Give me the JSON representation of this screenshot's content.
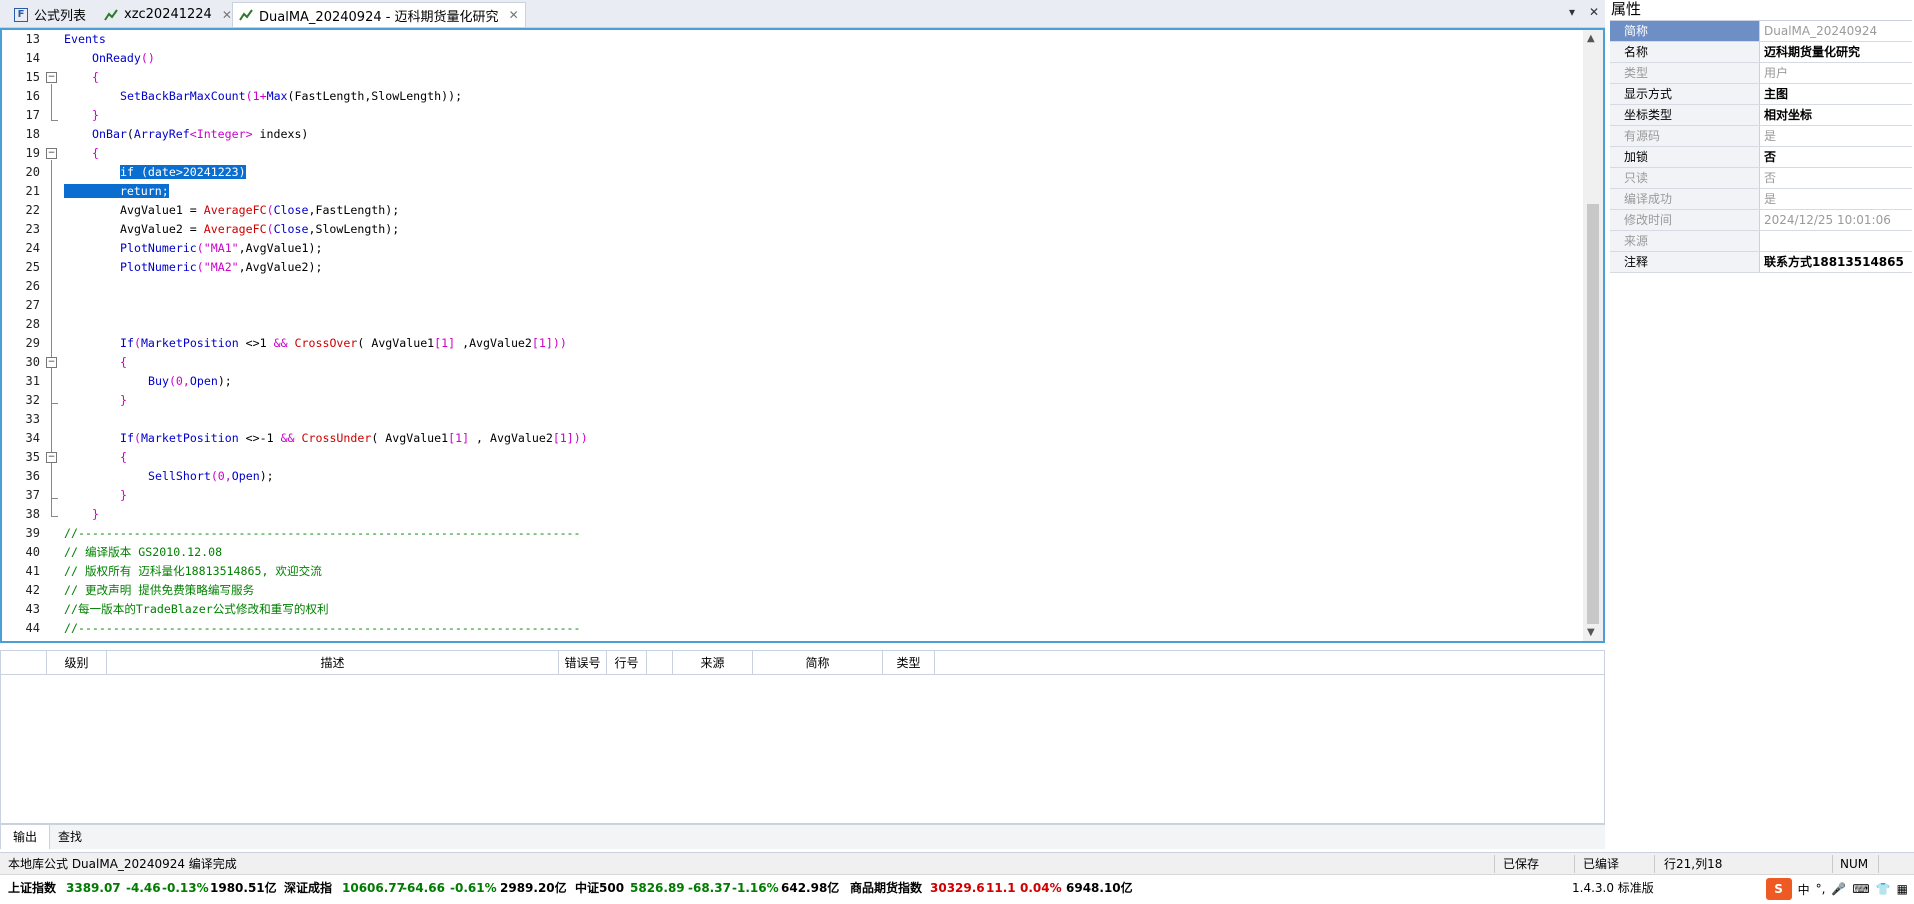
{
  "tabs": [
    {
      "label": "公式列表",
      "icon": "formula-list-icon"
    },
    {
      "label": "xzc20241224",
      "icon": "chart-line-icon"
    },
    {
      "label": "DualMA_20240924 - 迈科期货量化研究",
      "icon": "chart-line-icon"
    }
  ],
  "editor": {
    "line_numbers": [
      "13",
      "14",
      "15",
      "16",
      "17",
      "18",
      "19",
      "20",
      "21",
      "22",
      "23",
      "24",
      "25",
      "26",
      "27",
      "28",
      "29",
      "30",
      "31",
      "32",
      "33",
      "34",
      "35",
      "36",
      "37",
      "38",
      "39",
      "40",
      "41",
      "42",
      "43",
      "44"
    ]
  },
  "code": {
    "l13": "Events",
    "l14a": "OnReady",
    "l14b": "()",
    "l15": "{",
    "l16a": "SetBackBarMaxCount",
    "l16b": "(1+",
    "l16c": "Max",
    "l16d": "(FastLength,SlowLength));",
    "l17": "}",
    "l18a": "OnBar",
    "l18b": "(",
    "l18c": "ArrayRef",
    "l18d": "<Integer>",
    "l18e": " indexs)",
    "l19": "{",
    "l20": "if (date>20241223)",
    "l21": "return;",
    "l22a": "AvgValue1 = ",
    "l22b": "AverageFC",
    "l22c": "(",
    "l22d": "Close",
    "l22e": ",FastLength);",
    "l23a": "AvgValue2 = ",
    "l23b": "AverageFC",
    "l23c": "(",
    "l23d": "Close",
    "l23e": ",SlowLength);",
    "l24a": "PlotNumeric",
    "l24b": "(",
    "l24c": "\"MA1\"",
    "l24d": ",AvgValue1);",
    "l25a": "PlotNumeric",
    "l25b": "(",
    "l25c": "\"MA2\"",
    "l25d": ",AvgValue2);",
    "l29a": "If",
    "l29b": "(",
    "l29c": "MarketPosition",
    "l29d": " <>1 ",
    "l29e": "&&",
    "l29f": " CrossOver",
    "l29g": "( AvgValue1",
    "l29h": "[1]",
    "l29i": " ,AvgValue2",
    "l29j": "[1]",
    "l29k": "))",
    "l30": "{",
    "l31a": "Buy",
    "l31b": "(0,",
    "l31c": "Open",
    "l31d": ");",
    "l32": "}",
    "l34a": "If",
    "l34b": "(",
    "l34c": "MarketPosition",
    "l34d": " <>-1 ",
    "l34e": "&&",
    "l34f": " CrossUnder",
    "l34g": "( AvgValue1",
    "l34h": "[1]",
    "l34i": " , AvgValue2",
    "l34j": "[1]",
    "l34k": "))",
    "l35": "{",
    "l36a": "SellShort",
    "l36b": "(0,",
    "l36c": "Open",
    "l36d": ");",
    "l37": "}",
    "l38": "}",
    "l39": "//------------------------------------------------------------------------",
    "l40": "// 编译版本 GS2010.12.08",
    "l41": "// 版权所有 迈科量化18813514865, 欢迎交流",
    "l42": "// 更改声明 提供免费策略编写服务",
    "l43": "//每一版本的TradeBlazer公式修改和重写的权利",
    "l44": "//------------------------------------------------------------------------"
  },
  "errors": {
    "columns": [
      "级别",
      "描述",
      "错误号",
      "行号",
      "来源",
      "简称",
      "类型"
    ]
  },
  "output_tabs": [
    "输出",
    "查找"
  ],
  "status": {
    "message": "本地库公式 DualMA_20240924 编译完成",
    "saved": "已保存",
    "compiled": "已编译",
    "position": "行21,列18",
    "num": "NUM",
    "version": "1.4.3.0 标准版"
  },
  "market": [
    {
      "name": "上证指数",
      "price": "3389.07",
      "change": "-4.46",
      "pct": "-0.13%",
      "volume": "1980.51亿",
      "dir": "down"
    },
    {
      "name": "深证成指",
      "price": "10606.77",
      "change": "-64.66",
      "pct": "-0.61%",
      "volume": "2989.20亿",
      "dir": "down"
    },
    {
      "name": "中证500",
      "price": "5826.89",
      "change": "-68.37",
      "pct": "-1.16%",
      "volume": "642.98亿",
      "dir": "down"
    },
    {
      "name": "商品期货指数",
      "price": "30329.6",
      "change": "11.1",
      "pct": "0.04%",
      "volume": "6948.10亿",
      "dir": "up"
    }
  ],
  "properties": {
    "title": "属性",
    "rows": [
      {
        "key": "简称",
        "value": "DualMA_20240924"
      },
      {
        "key": "名称",
        "value": "迈科期货量化研究"
      },
      {
        "key": "类型",
        "value": "用户"
      },
      {
        "key": "显示方式",
        "value": "主图"
      },
      {
        "key": "坐标类型",
        "value": "相对坐标"
      },
      {
        "key": "有源码",
        "value": "是"
      },
      {
        "key": "加锁",
        "value": "否"
      },
      {
        "key": "只读",
        "value": "否"
      },
      {
        "key": "编译成功",
        "value": "是"
      },
      {
        "key": "修改时间",
        "value": "2024/12/25 10:01:06"
      },
      {
        "key": "来源",
        "value": ""
      },
      {
        "key": "注释",
        "value": "联系方式18813514865"
      }
    ]
  },
  "ime": {
    "mode": "中"
  },
  "colors": {
    "accent": "#4a9fd8",
    "selection": "#0a6ed1",
    "up": "#d00000",
    "down": "#007a00"
  }
}
